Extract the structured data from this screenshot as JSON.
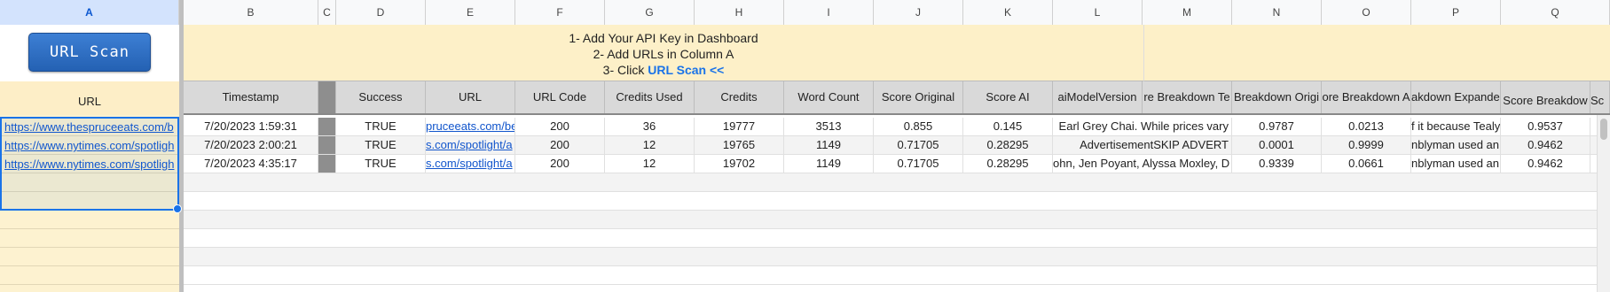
{
  "column_letters": [
    "A",
    "B",
    "C",
    "D",
    "E",
    "F",
    "G",
    "H",
    "I",
    "J",
    "K",
    "L",
    "M",
    "N",
    "O",
    "P",
    "Q"
  ],
  "button": {
    "label": "URL Scan"
  },
  "banner": {
    "line1": "1- Add Your API Key in Dashboard",
    "line2": "2- Add URLs in Column A",
    "line3_prefix": "3- Click ",
    "line3_keyword": "URL Scan <<"
  },
  "colA_header": "URL",
  "colA_urls": [
    "https://www.thespruceeats.com/b",
    "https://www.nytimes.com/spotligh",
    "https://www.nytimes.com/spotligh"
  ],
  "headers": {
    "B": "Timestamp",
    "C": "",
    "D": "Success",
    "E": "URL",
    "F": "URL Code",
    "G": "Credits Used",
    "H": "Credits",
    "I": "Word Count",
    "J": "Score Original",
    "K": "Score AI",
    "L": "aiModelVersion",
    "M": "re Breakdown Te",
    "N": "Breakdown Origi",
    "O": "ore Breakdown A",
    "P": "akdown Expanded",
    "Q": "Score Breakdow",
    "R": "Sc"
  },
  "rows": [
    {
      "B": "7/20/2023 1:59:31",
      "C": "",
      "D": "TRUE",
      "E": "pruceeats.com/be",
      "F": "200",
      "G": "36",
      "H": "19777",
      "I": "3513",
      "J": "0.855",
      "K": "0.145",
      "L": "Earl Grey Chai. While prices vary",
      "M": "",
      "N": "0.9787",
      "O": "0.0213",
      "P": "f it because Tealy",
      "Q": "0.9537"
    },
    {
      "B": "7/20/2023 2:00:21",
      "C": "",
      "D": "TRUE",
      "E": "s.com/spotlight/a",
      "F": "200",
      "G": "12",
      "H": "19765",
      "I": "1149",
      "J": "0.71705",
      "K": "0.28295",
      "L": "AdvertisementSKIP ADVERT",
      "M": "",
      "N": "0.0001",
      "O": "0.9999",
      "P": "nblyman used an",
      "Q": "0.9462"
    },
    {
      "B": "7/20/2023 4:35:17",
      "C": "",
      "D": "TRUE",
      "E": "s.com/spotlight/a",
      "F": "200",
      "G": "12",
      "H": "19702",
      "I": "1149",
      "J": "0.71705",
      "K": "0.28295",
      "L": "ohn, Jen Poyant, Alyssa Moxley, D",
      "M": "",
      "N": "0.9339",
      "O": "0.0661",
      "P": "nblyman used an",
      "Q": "0.9462"
    }
  ]
}
